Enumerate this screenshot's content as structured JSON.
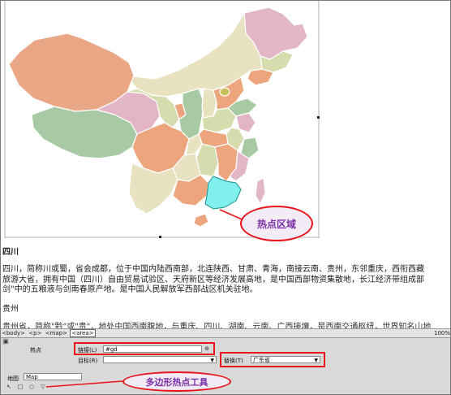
{
  "callouts": {
    "hotspot_area": "热点区域",
    "polygon_tool": "多边形热点工具"
  },
  "document": {
    "heading": "四川",
    "para1_line1": "四川，简称川或蜀，省会成都，位于中国内陆西南部，北连陕西、甘肃、青海，南接云南、贵州，东邻重庆，西衔西藏",
    "para1_line2": "旅游大省，拥有中国（四川）自由贸易试验区、天府新区等经济发展高地，是中国西部物资集散地，长江经济带组成部",
    "para1_line3": "剑\"中的五粮液与剑南春原产地。是中国人民解放军西部战区机关驻地。",
    "para2": "贵州",
    "para3": "贵州省，简称\"黔\"或\"贵\"，地处中国西南腹地，与重庆、四川、湖南、云南、广西接壤，是西南交通枢纽，世界知名山地"
  },
  "tag_bar": {
    "tags": [
      "<body>",
      "<p>",
      "<map>",
      "<area>"
    ],
    "selected_index": 3,
    "zoom": "100%"
  },
  "inspector": {
    "hotspot_label": "热点",
    "link_label": "链接(L)",
    "link_value": "#gd",
    "target_label": "目标(R)",
    "target_value": "",
    "replace_label": "替换(T)",
    "replace_value": "广东省",
    "map_label": "地图",
    "map_value": "Map"
  },
  "colors": {
    "annotation_red": "#e8131b",
    "annotation_text": "#7b2fa8",
    "hotspot_fill": "#7ff0ee",
    "inspector_bg": "#d9d9d9"
  },
  "icons": [
    "folder-icon",
    "pointer-tool-icon",
    "rect-tool-icon",
    "circle-tool-icon",
    "polygon-tool-icon",
    "dropdown-arrow-icon"
  ]
}
